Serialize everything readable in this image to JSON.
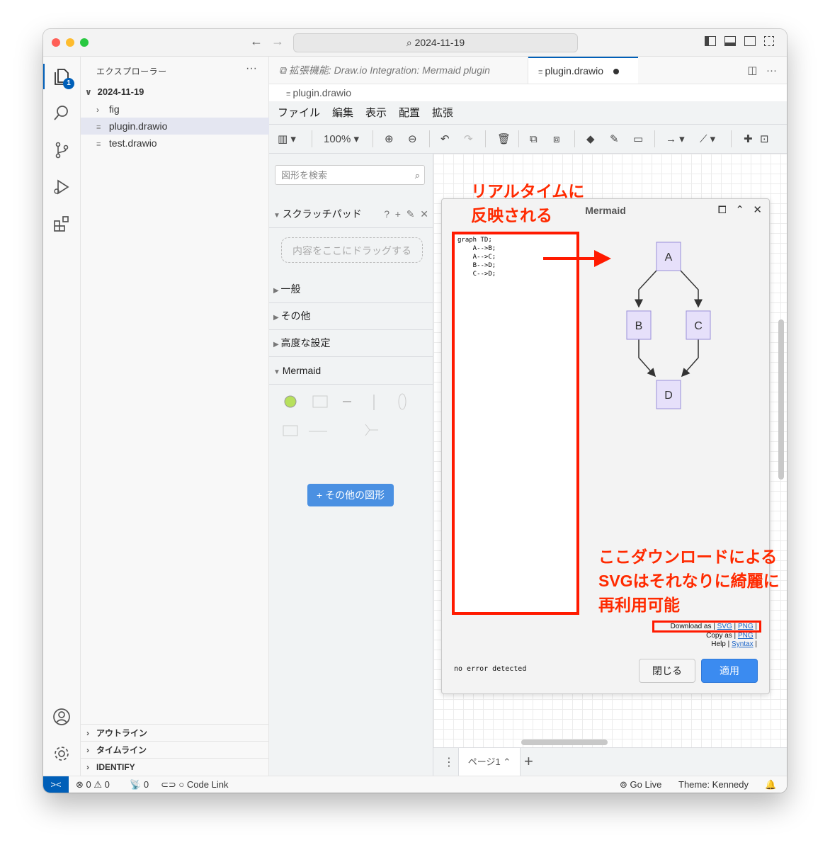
{
  "titlebar": {
    "search": "2024-11-19"
  },
  "explorer": {
    "title": "エクスプローラー",
    "badge": "1",
    "folder": "2024-11-19",
    "items": [
      {
        "label": "fig"
      },
      {
        "label": "plugin.drawio"
      },
      {
        "label": "test.drawio"
      }
    ],
    "sections": [
      "アウトライン",
      "タイムライン",
      "IDENTIFY"
    ]
  },
  "tabs": [
    {
      "label": "拡張機能: Draw.io Integration: Mermaid plugin"
    },
    {
      "label": "plugin.drawio"
    }
  ],
  "breadcrumb": "plugin.drawio",
  "drawio": {
    "menus": [
      "ファイル",
      "編集",
      "表示",
      "配置",
      "拡張"
    ],
    "zoom": "100%",
    "search_placeholder": "図形を検索",
    "scratchpad": {
      "title": "スクラッチパッド",
      "help": "?",
      "dropzone": "内容をここにドラッグする"
    },
    "libraries": [
      "一般",
      "その他",
      "高度な設定",
      "Mermaid"
    ],
    "more_shapes": "+ その他の図形",
    "page_tab": "ページ1"
  },
  "dialog": {
    "title": "Mermaid",
    "code": "graph TD;\n    A-->B;\n    A-->C;\n    B-->D;\n    C-->D;",
    "nodes": [
      "A",
      "B",
      "C",
      "D"
    ],
    "download_label": "Download as |",
    "copy_label": "Copy as |",
    "help_label": "Help |",
    "svg": "SVG",
    "png": "PNG",
    "syntax": "Syntax",
    "sep": "|",
    "status": "no error detected",
    "close": "閉じる",
    "apply": "適用"
  },
  "annotations": {
    "realtime_line1": "リアルタイムに",
    "realtime_line2": "反映される",
    "download_line1": "ここダウンロードによる",
    "download_line2": "SVGはそれなりに綺麗に",
    "download_line3": "再利用可能"
  },
  "statusbar": {
    "errors": "0",
    "warnings": "0",
    "ports": "0",
    "code_link": "Code Link",
    "go_live": "Go Live",
    "theme": "Theme: Kennedy"
  },
  "colors": {
    "accent": "#005fb8",
    "annotation": "#ff2a00",
    "node_fill": "#e6e0fa",
    "node_stroke": "#9a8fd9",
    "apply_button": "#3b8bf0"
  }
}
